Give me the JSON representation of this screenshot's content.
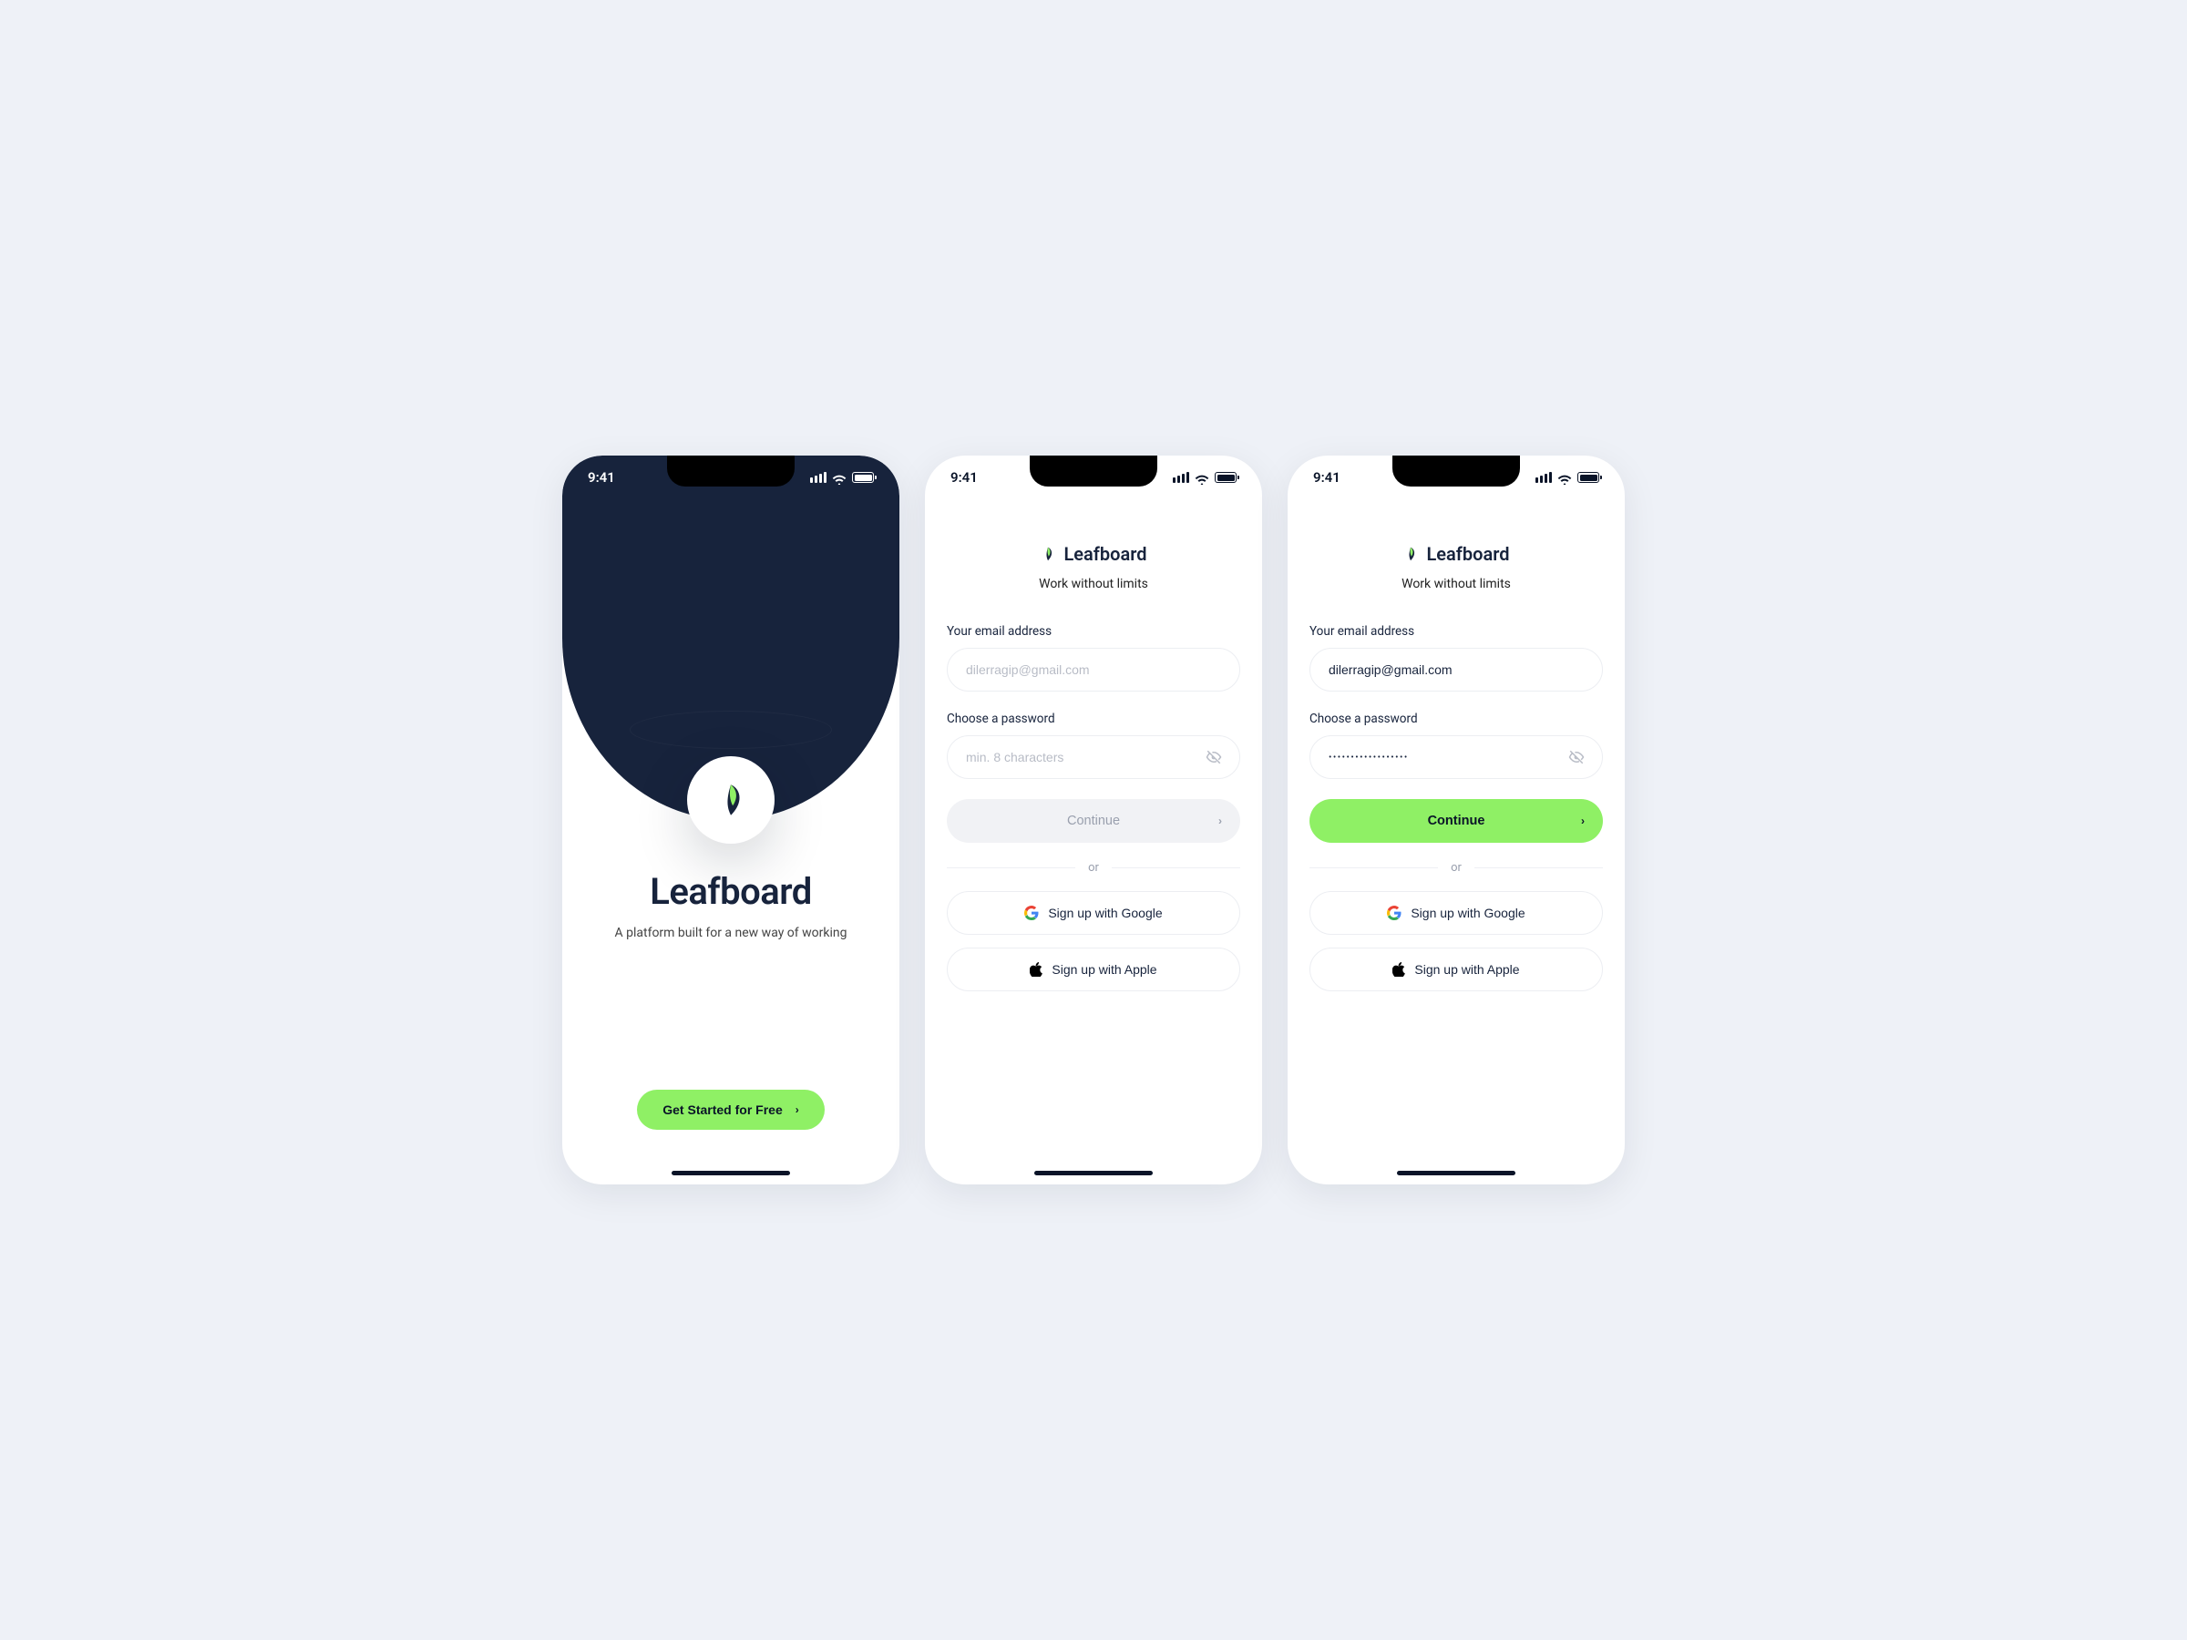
{
  "status": {
    "time": "9:41"
  },
  "brand": {
    "name": "Leafboard"
  },
  "screen1": {
    "title": "Leafboard",
    "subtitle": "A platform built for a new way of working",
    "cta": "Get Started for Free"
  },
  "screen2": {
    "tagline": "Work without limits",
    "email_label": "Your email address",
    "email_placeholder": "dilerragip@gmail.com",
    "password_label": "Choose a password",
    "password_placeholder": "min. 8 characters",
    "continue": "Continue",
    "or": "or",
    "google": "Sign up with Google",
    "apple": "Sign up with Apple"
  },
  "screen3": {
    "tagline": "Work without limits",
    "email_label": "Your email address",
    "email_value": "dilerragip@gmail.com",
    "password_label": "Choose a password",
    "password_masked": "••••••••••••••••••",
    "continue": "Continue",
    "or": "or",
    "google": "Sign up with Google",
    "apple": "Sign up with Apple"
  }
}
